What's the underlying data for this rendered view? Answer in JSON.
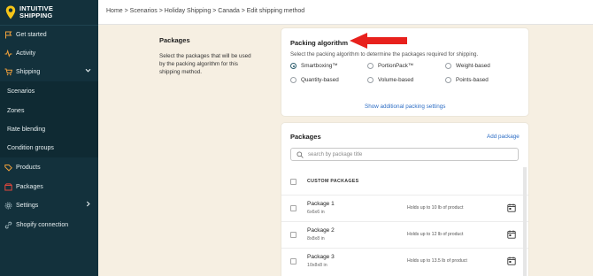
{
  "brand": {
    "line1": "INTUITIVE",
    "line2": "SHIPPING"
  },
  "sidebar": {
    "items": [
      {
        "label": "Get started",
        "icon": "flag-icon"
      },
      {
        "label": "Activity",
        "icon": "activity-icon"
      },
      {
        "label": "Shipping",
        "icon": "cart-icon"
      },
      {
        "label": "Scenarios"
      },
      {
        "label": "Zones"
      },
      {
        "label": "Rate blending"
      },
      {
        "label": "Condition groups"
      },
      {
        "label": "Products",
        "icon": "tag-icon"
      },
      {
        "label": "Packages",
        "icon": "box-icon"
      },
      {
        "label": "Settings",
        "icon": "gear-icon"
      },
      {
        "label": "Shopify connection",
        "icon": "link-icon"
      }
    ]
  },
  "breadcrumb": "Home > Scenarios > Holiday Shipping > Canada > Edit shipping method",
  "packages_section": {
    "title": "Packages",
    "description": "Select the packages that will be used by the packing algorithm for this shipping method."
  },
  "packing_algorithm": {
    "title": "Packing algorithm",
    "description": "Select the packing algorithm to determine the packages required for shipping.",
    "options": [
      "Smartboxing™",
      "PortionPack™",
      "Weight-based",
      "Quantity-based",
      "Volume-based",
      "Points-based"
    ],
    "selected": "Smartboxing™",
    "link": "Show additional packing settings"
  },
  "packages_card": {
    "title": "Packages",
    "add_label": "Add package",
    "search_placeholder": "search by package title",
    "column_header": "CUSTOM PACKAGES",
    "rows": [
      {
        "name": "Package 1",
        "dims": "6x6x6 in",
        "holds": "Holds up to 10 lb of product"
      },
      {
        "name": "Package 2",
        "dims": "8x8x8 in",
        "holds": "Holds up to 12 lb of product"
      },
      {
        "name": "Package 3",
        "dims": "10x8x8 in",
        "holds": "Holds up to 13.5 lb of product"
      }
    ]
  },
  "colors": {
    "sidebar": "#13313c",
    "accent": "#2b6cc4",
    "annotation": "#e8211d",
    "background": "#f6efe2"
  }
}
